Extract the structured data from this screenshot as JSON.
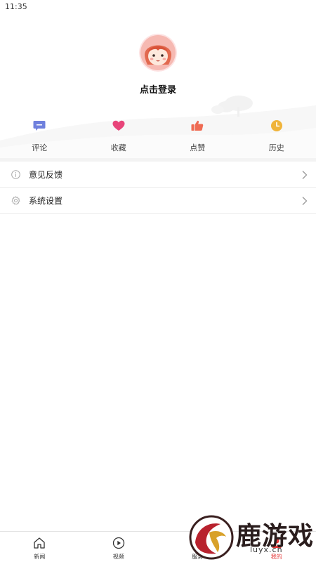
{
  "status_bar": {
    "time": "11:35"
  },
  "profile": {
    "login_text": "点击登录"
  },
  "shortcuts": [
    {
      "label": "评论",
      "icon": "comment-icon",
      "color": "#6f80dd"
    },
    {
      "label": "收藏",
      "icon": "heart-icon",
      "color": "#e8457a"
    },
    {
      "label": "点赞",
      "icon": "thumbs-up-icon",
      "color": "#ef6b53"
    },
    {
      "label": "历史",
      "icon": "clock-icon",
      "color": "#f0b43a"
    }
  ],
  "menu": [
    {
      "label": "意见反馈",
      "icon": "info-icon"
    },
    {
      "label": "系统设置",
      "icon": "gear-icon"
    }
  ],
  "tabs": [
    {
      "label": "新闻",
      "icon": "home-icon"
    },
    {
      "label": "视频",
      "icon": "play-icon"
    },
    {
      "label": "服务",
      "icon": "service-icon"
    },
    {
      "label": "我的",
      "icon": "person-icon",
      "active": true
    }
  ],
  "watermark": {
    "text": "鹿游戏",
    "url": "luyx.cn"
  },
  "colors": {
    "accent": "#e43b3b",
    "divider": "#f3f3f3"
  }
}
